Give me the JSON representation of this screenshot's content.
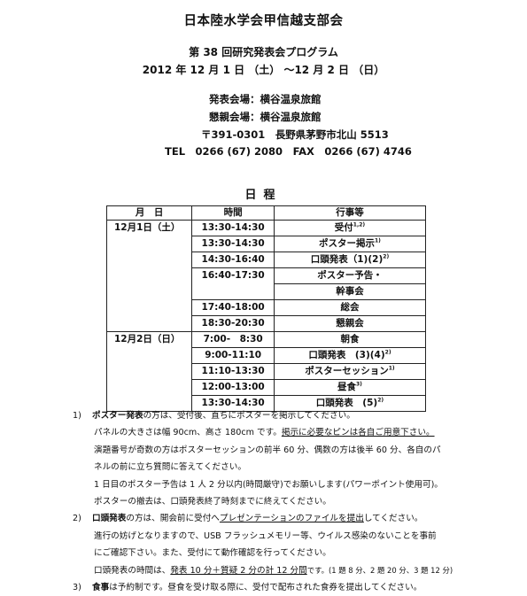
{
  "header": {
    "org": "日本陸水学会甲信越支部会",
    "program": "第 38 回研究発表会プログラム",
    "dates": "2012 年 12 月 1 日 （土） ～12 月 2 日 （日）"
  },
  "venue": {
    "presentation": "発表会場：横谷温泉旅館",
    "reception": "懇親会場：横谷温泉旅館",
    "address": "〒391-0301　長野県茅野市北山 5513",
    "tel": "TEL　0266 (67) 2080　FAX　0266 (67) 4746"
  },
  "schedule": {
    "title": "日程",
    "headers": {
      "date": "月　日",
      "time": "時間",
      "event": "行事等"
    },
    "day1": "12月1日（土）",
    "day2": "12月2日（日）",
    "rows_day1": [
      {
        "time": "13:30-14:30",
        "event": "受付",
        "sup": "1,2)"
      },
      {
        "time": "13:30-14:30",
        "event": "ポスター掲示",
        "sup": "1)"
      },
      {
        "time": "14:30-16:40",
        "event": "口頭発表（1)(2)",
        "sup": "2)"
      },
      {
        "time": "16:40-17:30",
        "event": "ポスター予告・",
        "event2": "幹事会",
        "sup": ""
      },
      {
        "time": "17:40-18:00",
        "event": "総会",
        "sup": ""
      },
      {
        "time": "18:30-20:30",
        "event": "懇親会",
        "sup": ""
      }
    ],
    "rows_day2": [
      {
        "time": "7:00-　8:30",
        "event": "朝食",
        "sup": ""
      },
      {
        "time": "9:00-11:10",
        "event": "口頭発表　(3)(4)",
        "sup": "2)"
      },
      {
        "time": "11:10-13:30",
        "event": "ポスターセッション",
        "sup": "1)"
      },
      {
        "time": "12:00-13:00",
        "event": "昼食",
        "sup": "3)"
      },
      {
        "time": "13:30-14:30",
        "event": "口頭発表　(5)",
        "sup": "2)"
      }
    ]
  },
  "notes": {
    "n1": {
      "num": "1)",
      "bold": "ポスター発表",
      "text": "の方は、受付後、直ちにポスターを掲示してください。",
      "l2a": "パネルの大きさは幅 90cm、高さ 180cm です。",
      "l2u": "掲示に必要なピンは各自ご用意下さい。",
      "l3": "演題番号が奇数の方はポスターセッションの前半 60 分、偶数の方は後半 60 分、各自のパ",
      "l4": "ネルの前に立ち質問に答えてください。",
      "l5": "1 日目のポスター予告は 1 人 2 分以内(時間厳守)でお願いします(パワーポイント使用可)。",
      "l6": "ポスターの撤去は、口頭発表終了時刻までに終えてください。"
    },
    "n2": {
      "num": "2)",
      "bold": "口頭発表",
      "text_a": "の方は、開会前に受付へ",
      "text_u": "プレゼンテーションのファイルを提出",
      "text_b": "してください。",
      "l2": "進行の妨げとなりますので、USB フラッシュメモリー等、ウイルス感染のないことを事前",
      "l3": "にご確認下さい。また、受付にて動作確認を行ってください。",
      "l4a": "口頭発表の時間は、",
      "l4u": "発表 10 分＋質疑 2 分の計 12 分間",
      "l4b": "です。(1 題 8 分、2 題 20 分、3 題 12 分)"
    },
    "n3": {
      "num": "3)",
      "bold": "食事",
      "text": "は予約制です。昼食を受け取る際に、受付で配布された食券を提出してください。"
    }
  }
}
